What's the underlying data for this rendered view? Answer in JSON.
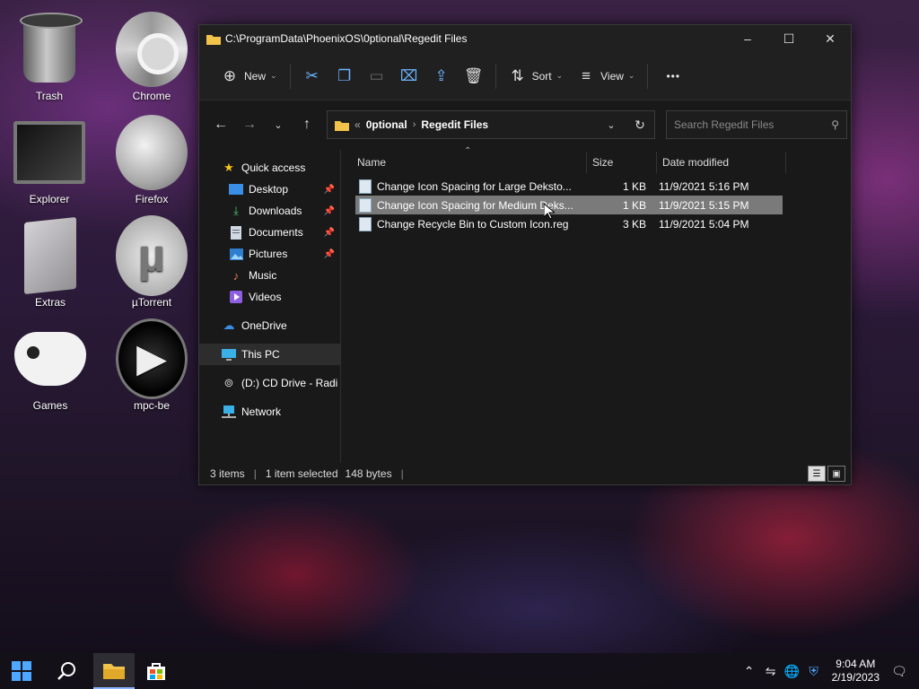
{
  "desktop": {
    "icons": [
      {
        "label": "Trash",
        "icon": "trash-icon"
      },
      {
        "label": "Chrome",
        "icon": "chrome-icon"
      },
      {
        "label": "Explorer",
        "icon": "monitor-icon"
      },
      {
        "label": "Firefox",
        "icon": "firefox-icon"
      },
      {
        "label": "Extras",
        "icon": "folder-icon"
      },
      {
        "label": "µTorrent",
        "icon": "utorrent-icon"
      },
      {
        "label": "Games",
        "icon": "gamepad-icon"
      },
      {
        "label": "mpc-be",
        "icon": "play-icon"
      }
    ]
  },
  "window": {
    "title": "C:\\ProgramData\\PhoenixOS\\0ptional\\Regedit Files",
    "minimize": "–",
    "maximize": "☐",
    "close": "✕"
  },
  "toolbar": {
    "new_label": "New",
    "sort_label": "Sort",
    "view_label": "View",
    "more_label": "•••"
  },
  "address": {
    "prefix": "«",
    "crumbs": [
      "0ptional",
      "Regedit Files"
    ]
  },
  "search": {
    "placeholder": "Search Regedit Files"
  },
  "nav": {
    "items": [
      {
        "label": "Quick access",
        "icon": "star-icon"
      },
      {
        "label": "Desktop",
        "icon": "desktop-icon"
      },
      {
        "label": "Downloads",
        "icon": "download-icon"
      },
      {
        "label": "Documents",
        "icon": "document-icon"
      },
      {
        "label": "Pictures",
        "icon": "picture-icon"
      },
      {
        "label": "Music",
        "icon": "music-icon"
      },
      {
        "label": "Videos",
        "icon": "video-icon"
      },
      {
        "label": "OneDrive",
        "icon": "cloud-icon"
      },
      {
        "label": "This PC",
        "icon": "pc-icon"
      },
      {
        "label": "(D:) CD Drive - Radi",
        "icon": "cd-drive-icon"
      },
      {
        "label": "Network",
        "icon": "network-icon"
      }
    ]
  },
  "columns": {
    "name": "Name",
    "size": "Size",
    "date": "Date modified"
  },
  "files": [
    {
      "name": "Change Icon Spacing for Large Deksto...",
      "size": "1 KB",
      "date": "11/9/2021 5:16 PM"
    },
    {
      "name": "Change Icon Spacing for Medium Deks...",
      "size": "1 KB",
      "date": "11/9/2021 5:15 PM"
    },
    {
      "name": "Change Recycle Bin to Custom Icon.reg",
      "size": "3 KB",
      "date": "11/9/2021 5:04 PM"
    }
  ],
  "status": {
    "count": "3 items",
    "selected": "1 item selected",
    "bytes": "148 bytes"
  },
  "taskbar": {
    "time": "9:04 AM",
    "date": "2/19/2023"
  },
  "colors": {
    "window_bg": "#191919",
    "selection": "#7a7a7a",
    "accent": "#6cb4ff"
  }
}
